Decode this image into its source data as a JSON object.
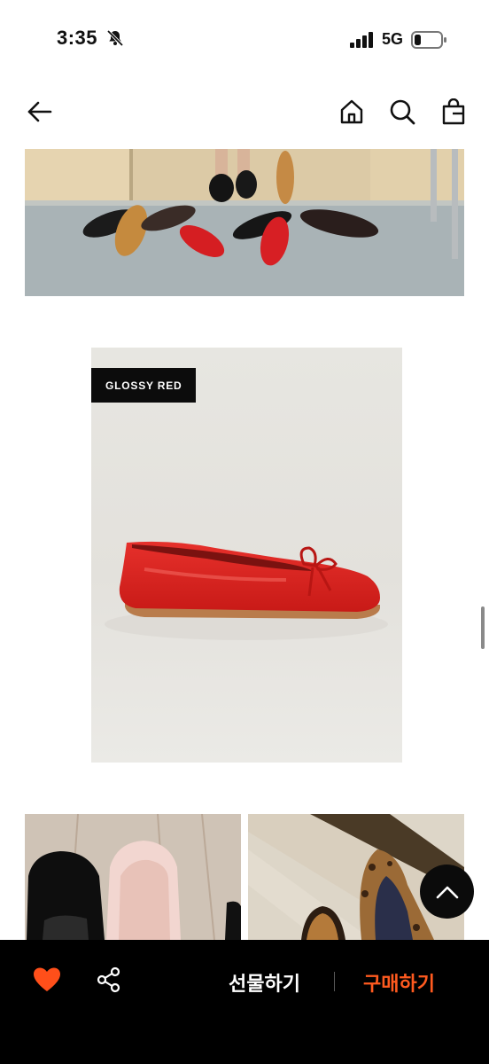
{
  "status_bar": {
    "time": "3:35",
    "network": "5G"
  },
  "header": {
    "back_icon": "arrow-left-icon",
    "home_icon": "home-icon",
    "search_icon": "search-icon",
    "bag_icon": "shopping-bag-icon"
  },
  "product": {
    "color_tag": "GLOSSY RED"
  },
  "bottom_bar": {
    "like_icon": "heart-icon",
    "share_icon": "share-icon",
    "gift_label": "선물하기",
    "buy_label": "구매하기",
    "accent_color": "#ff5a1f",
    "heart_color": "#ff4f1a"
  },
  "scroll_top_icon": "chevron-up-icon"
}
